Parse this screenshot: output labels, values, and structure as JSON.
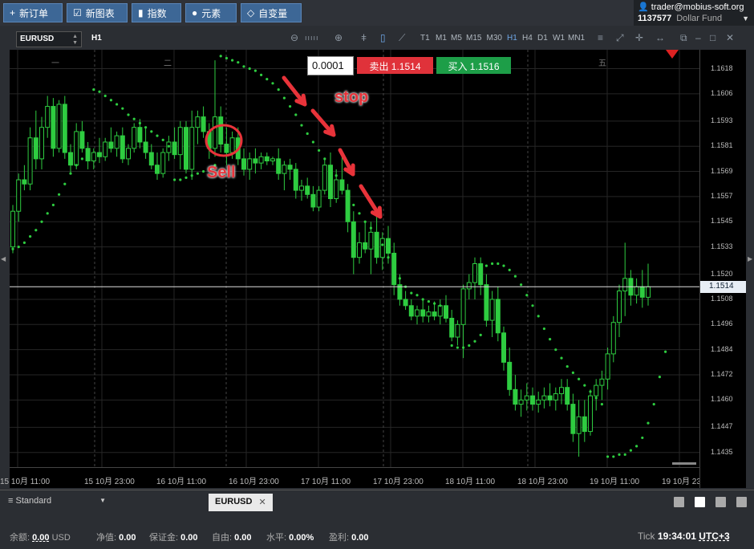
{
  "toolbar_top": {
    "new_order": "新订单",
    "new_chart": "新图表",
    "indicators": "指数",
    "elements": "元素",
    "custom_vars": "自变量"
  },
  "account": {
    "user": "trader@mobius-soft.org",
    "number": "1137577",
    "name": "Dollar Fund"
  },
  "chart_toolbar": {
    "symbol": "EURUSD",
    "period": "H1",
    "timeframes": [
      "T1",
      "M1",
      "M5",
      "M15",
      "M30",
      "H1",
      "H4",
      "D1",
      "W1",
      "MN1"
    ],
    "active_timeframe": "H1"
  },
  "trade_panel": {
    "lot": "0.0001",
    "sell_label": "卖出 1.1514",
    "buy_label": "买入 1.1516"
  },
  "annotations": {
    "stop": "stop",
    "sell": "Sell"
  },
  "day_labels": [
    "一",
    "二",
    "五"
  ],
  "current_price": "1.1514",
  "chart_data": {
    "type": "candlestick",
    "symbol": "EURUSD",
    "timeframe": "H1",
    "x_ticks": [
      "15 10月 11:00",
      "15 10月 23:00",
      "16 10月 11:00",
      "16 10月 23:00",
      "17 10月 11:00",
      "17 10月 23:00",
      "18 10月 11:00",
      "18 10月 23:00",
      "19 10月 11:00",
      "19 10月 23:00"
    ],
    "x_tick_first_partial": "15 10月 11:00",
    "y_ticks": [
      "1.1618",
      "1.1606",
      "1.1593",
      "1.1581",
      "1.1569",
      "1.1557",
      "1.1545",
      "1.1533",
      "1.1520",
      "1.1508",
      "1.1496",
      "1.1484",
      "1.1472",
      "1.1460",
      "1.1447",
      "1.1435"
    ],
    "ylim": [
      1.1428,
      1.1627
    ],
    "current_price": 1.1514,
    "indicator": "Parabolic SAR",
    "colors": {
      "bull": "#2ecc40",
      "bear": "#2ecc40",
      "sar": "#2ecc40",
      "background": "#000000",
      "grid": "#2a2a2a"
    },
    "candles": [
      [
        1.1533,
        1.1553,
        1.153,
        1.155
      ],
      [
        1.155,
        1.1568,
        1.1545,
        1.1565
      ],
      [
        1.1565,
        1.1572,
        1.156,
        1.1563
      ],
      [
        1.1563,
        1.159,
        1.156,
        1.1585
      ],
      [
        1.1585,
        1.1598,
        1.157,
        1.1575
      ],
      [
        1.1575,
        1.1595,
        1.157,
        1.159
      ],
      [
        1.159,
        1.1605,
        1.1585,
        1.16
      ],
      [
        1.16,
        1.1604,
        1.1576,
        1.158
      ],
      [
        1.158,
        1.1603,
        1.1578,
        1.1601
      ],
      [
        1.1601,
        1.1605,
        1.1575,
        1.1578
      ],
      [
        1.1578,
        1.1582,
        1.1568,
        1.1572
      ],
      [
        1.1572,
        1.1592,
        1.157,
        1.1588
      ],
      [
        1.1588,
        1.1593,
        1.1578,
        1.158
      ],
      [
        1.158,
        1.1583,
        1.157,
        1.1574
      ],
      [
        1.1574,
        1.158,
        1.157,
        1.1578
      ],
      [
        1.1578,
        1.1585,
        1.1573,
        1.1576
      ],
      [
        1.1576,
        1.1585,
        1.1574,
        1.1583
      ],
      [
        1.1583,
        1.159,
        1.1578,
        1.158
      ],
      [
        1.158,
        1.1588,
        1.1576,
        1.1586
      ],
      [
        1.1586,
        1.159,
        1.1573,
        1.1575
      ],
      [
        1.1575,
        1.1582,
        1.1572,
        1.158
      ],
      [
        1.158,
        1.1592,
        1.1578,
        1.159
      ],
      [
        1.159,
        1.1594,
        1.158,
        1.1583
      ],
      [
        1.1583,
        1.159,
        1.1575,
        1.1578
      ],
      [
        1.1578,
        1.1582,
        1.157,
        1.1572
      ],
      [
        1.1572,
        1.1578,
        1.1565,
        1.1568
      ],
      [
        1.1568,
        1.158,
        1.1566,
        1.1578
      ],
      [
        1.1578,
        1.1586,
        1.1574,
        1.1583
      ],
      [
        1.1583,
        1.159,
        1.1575,
        1.1577
      ],
      [
        1.1577,
        1.1593,
        1.157,
        1.159
      ],
      [
        1.159,
        1.1593,
        1.1568,
        1.157
      ],
      [
        1.157,
        1.1598,
        1.1565,
        1.159
      ],
      [
        1.159,
        1.1598,
        1.1582,
        1.1595
      ],
      [
        1.1595,
        1.16,
        1.1585,
        1.1588
      ],
      [
        1.1588,
        1.1592,
        1.1575,
        1.158
      ],
      [
        1.158,
        1.1622,
        1.1576,
        1.1595
      ],
      [
        1.1595,
        1.16,
        1.1578,
        1.1582
      ],
      [
        1.1582,
        1.159,
        1.1572,
        1.1578
      ],
      [
        1.1578,
        1.1588,
        1.1575,
        1.1585
      ],
      [
        1.1585,
        1.159,
        1.1572,
        1.1575
      ],
      [
        1.1575,
        1.158,
        1.1567,
        1.157
      ],
      [
        1.157,
        1.1578,
        1.1565,
        1.1575
      ],
      [
        1.1575,
        1.158,
        1.1568,
        1.1573
      ],
      [
        1.1573,
        1.1578,
        1.157,
        1.1576
      ],
      [
        1.1576,
        1.1578,
        1.1572,
        1.1574
      ],
      [
        1.1574,
        1.1576,
        1.1572,
        1.1575
      ],
      [
        1.1575,
        1.158,
        1.1565,
        1.1568
      ],
      [
        1.1568,
        1.1574,
        1.156,
        1.1572
      ],
      [
        1.1572,
        1.1575,
        1.1565,
        1.157
      ],
      [
        1.157,
        1.1573,
        1.1556,
        1.156
      ],
      [
        1.156,
        1.1565,
        1.1555,
        1.1562
      ],
      [
        1.1562,
        1.1566,
        1.1556,
        1.1558
      ],
      [
        1.1558,
        1.1562,
        1.155,
        1.1552
      ],
      [
        1.1552,
        1.1562,
        1.155,
        1.156
      ],
      [
        1.156,
        1.1575,
        1.1558,
        1.1572
      ],
      [
        1.1572,
        1.1578,
        1.1552,
        1.1556
      ],
      [
        1.1556,
        1.157,
        1.1554,
        1.1565
      ],
      [
        1.1565,
        1.1578,
        1.1558,
        1.156
      ],
      [
        1.156,
        1.1563,
        1.154,
        1.1545
      ],
      [
        1.1545,
        1.155,
        1.152,
        1.1528
      ],
      [
        1.1528,
        1.154,
        1.1525,
        1.1535
      ],
      [
        1.1535,
        1.1545,
        1.153,
        1.1532
      ],
      [
        1.1532,
        1.1545,
        1.152,
        1.154
      ],
      [
        1.154,
        1.155,
        1.1525,
        1.1528
      ],
      [
        1.1528,
        1.154,
        1.1522,
        1.1537
      ],
      [
        1.1537,
        1.1543,
        1.1525,
        1.153
      ],
      [
        1.153,
        1.1535,
        1.151,
        1.1515
      ],
      [
        1.1515,
        1.152,
        1.1505,
        1.1508
      ],
      [
        1.1508,
        1.1512,
        1.1503,
        1.1505
      ],
      [
        1.1505,
        1.1508,
        1.1498,
        1.15
      ],
      [
        1.15,
        1.1505,
        1.1496,
        1.1503
      ],
      [
        1.1503,
        1.1508,
        1.1497,
        1.15
      ],
      [
        1.15,
        1.1505,
        1.1497,
        1.1502
      ],
      [
        1.1502,
        1.1507,
        1.1498,
        1.15
      ],
      [
        1.15,
        1.1508,
        1.1496,
        1.1505
      ],
      [
        1.1505,
        1.151,
        1.1497,
        1.1499
      ],
      [
        1.1499,
        1.1503,
        1.1488,
        1.149
      ],
      [
        1.149,
        1.1498,
        1.1486,
        1.1496
      ],
      [
        1.1496,
        1.1515,
        1.148,
        1.1513
      ],
      [
        1.1513,
        1.152,
        1.1508,
        1.1516
      ],
      [
        1.1516,
        1.1528,
        1.1508,
        1.1525
      ],
      [
        1.1525,
        1.1528,
        1.151,
        1.1515
      ],
      [
        1.1515,
        1.152,
        1.1495,
        1.1498
      ],
      [
        1.1498,
        1.1512,
        1.149,
        1.1508
      ],
      [
        1.1508,
        1.1514,
        1.1488,
        1.1492
      ],
      [
        1.1492,
        1.1495,
        1.1474,
        1.1478
      ],
      [
        1.1478,
        1.1485,
        1.1462,
        1.1465
      ],
      [
        1.1465,
        1.1472,
        1.1455,
        1.1458
      ],
      [
        1.1458,
        1.1465,
        1.1452,
        1.146
      ],
      [
        1.146,
        1.1468,
        1.1455,
        1.1462
      ],
      [
        1.1462,
        1.1466,
        1.1455,
        1.1458
      ],
      [
        1.1458,
        1.1464,
        1.1454,
        1.146
      ],
      [
        1.146,
        1.1466,
        1.1456,
        1.1462
      ],
      [
        1.1462,
        1.1468,
        1.1457,
        1.146
      ],
      [
        1.146,
        1.1466,
        1.1455,
        1.1463
      ],
      [
        1.1463,
        1.147,
        1.1458,
        1.1466
      ],
      [
        1.1466,
        1.147,
        1.1455,
        1.1458
      ],
      [
        1.1458,
        1.1463,
        1.144,
        1.1444
      ],
      [
        1.1444,
        1.146,
        1.1433,
        1.1452
      ],
      [
        1.1452,
        1.146,
        1.144,
        1.1445
      ],
      [
        1.1445,
        1.1465,
        1.1443,
        1.1462
      ],
      [
        1.1462,
        1.147,
        1.1455,
        1.1467
      ],
      [
        1.1467,
        1.1474,
        1.146,
        1.147
      ],
      [
        1.147,
        1.1485,
        1.1465,
        1.1482
      ],
      [
        1.1482,
        1.15,
        1.1478,
        1.1497
      ],
      [
        1.1497,
        1.1515,
        1.149,
        1.1512
      ],
      [
        1.1512,
        1.1535,
        1.15,
        1.1518
      ],
      [
        1.1518,
        1.1522,
        1.1505,
        1.151
      ],
      [
        1.151,
        1.1518,
        1.1506,
        1.1514
      ],
      [
        1.1514,
        1.1522,
        1.1504,
        1.1509
      ],
      [
        1.1509,
        1.1525,
        1.1505,
        1.1514
      ]
    ],
    "sar": [
      [
        0,
        1.1532
      ],
      [
        1,
        1.1533
      ],
      [
        2,
        1.1535
      ],
      [
        3,
        1.1538
      ],
      [
        4,
        1.1541
      ],
      [
        5,
        1.1545
      ],
      [
        6,
        1.1549
      ],
      [
        7,
        1.1553
      ],
      [
        8,
        1.1558
      ],
      [
        9,
        1.1563
      ],
      [
        10,
        1.1568
      ],
      [
        11,
        1.1572
      ],
      [
        12,
        1.1575
      ],
      [
        13,
        1.1578
      ],
      [
        14,
        1.1608
      ],
      [
        15,
        1.1607
      ],
      [
        16,
        1.1605
      ],
      [
        17,
        1.1603
      ],
      [
        18,
        1.1601
      ],
      [
        19,
        1.1599
      ],
      [
        20,
        1.1596
      ],
      [
        21,
        1.1594
      ],
      [
        22,
        1.1592
      ],
      [
        23,
        1.159
      ],
      [
        24,
        1.1588
      ],
      [
        25,
        1.1586
      ],
      [
        26,
        1.1584
      ],
      [
        27,
        1.1581
      ],
      [
        28,
        1.1565
      ],
      [
        29,
        1.1565
      ],
      [
        30,
        1.1566
      ],
      [
        31,
        1.1567
      ],
      [
        32,
        1.1568
      ],
      [
        33,
        1.1569
      ],
      [
        34,
        1.157
      ],
      [
        35,
        1.1572
      ],
      [
        36,
        1.1624
      ],
      [
        37,
        1.1623
      ],
      [
        38,
        1.1622
      ],
      [
        39,
        1.1621
      ],
      [
        40,
        1.1619
      ],
      [
        41,
        1.1618
      ],
      [
        42,
        1.1617
      ],
      [
        43,
        1.1615
      ],
      [
        44,
        1.1613
      ],
      [
        45,
        1.1611
      ],
      [
        46,
        1.1608
      ],
      [
        47,
        1.1604
      ],
      [
        48,
        1.16
      ],
      [
        49,
        1.1596
      ],
      [
        50,
        1.1591
      ],
      [
        51,
        1.1587
      ],
      [
        52,
        1.1583
      ],
      [
        53,
        1.1579
      ],
      [
        54,
        1.1575
      ],
      [
        55,
        1.1571
      ],
      [
        56,
        1.1567
      ],
      [
        57,
        1.1562
      ],
      [
        58,
        1.1558
      ],
      [
        59,
        1.1553
      ],
      [
        60,
        1.1549
      ],
      [
        61,
        1.1545
      ],
      [
        62,
        1.1542
      ],
      [
        63,
        1.1538
      ],
      [
        64,
        1.1534
      ],
      [
        65,
        1.1528
      ],
      [
        66,
        1.1523
      ],
      [
        67,
        1.1518
      ],
      [
        68,
        1.1514
      ],
      [
        69,
        1.1511
      ],
      [
        70,
        1.151
      ],
      [
        71,
        1.1508
      ],
      [
        72,
        1.1507
      ],
      [
        73,
        1.1506
      ],
      [
        74,
        1.1505
      ],
      [
        75,
        1.1504
      ],
      [
        76,
        1.1486
      ],
      [
        77,
        1.1485
      ],
      [
        78,
        1.1485
      ],
      [
        79,
        1.1486
      ],
      [
        80,
        1.1488
      ],
      [
        81,
        1.1491
      ],
      [
        82,
        1.1524
      ],
      [
        83,
        1.1525
      ],
      [
        84,
        1.1525
      ],
      [
        85,
        1.1524
      ],
      [
        86,
        1.1522
      ],
      [
        87,
        1.1519
      ],
      [
        88,
        1.1515
      ],
      [
        89,
        1.151
      ],
      [
        90,
        1.1505
      ],
      [
        91,
        1.15
      ],
      [
        92,
        1.1494
      ],
      [
        93,
        1.1489
      ],
      [
        94,
        1.1484
      ],
      [
        95,
        1.148
      ],
      [
        96,
        1.1476
      ],
      [
        97,
        1.1473
      ],
      [
        98,
        1.147
      ],
      [
        99,
        1.1467
      ],
      [
        100,
        1.1464
      ],
      [
        101,
        1.1461
      ],
      [
        102,
        1.1458
      ],
      [
        103,
        1.1433
      ],
      [
        104,
        1.1433
      ],
      [
        105,
        1.1434
      ],
      [
        106,
        1.1434
      ],
      [
        107,
        1.1436
      ],
      [
        108,
        1.1438
      ],
      [
        109,
        1.1442
      ],
      [
        110,
        1.1449
      ],
      [
        111,
        1.1458
      ],
      [
        112,
        1.1471
      ],
      [
        113,
        1.1483
      ]
    ]
  },
  "bottom_tabs": {
    "layout": "Standard",
    "active_tab": "EURUSD"
  },
  "status": {
    "balance_label": "余额:",
    "balance": "0.00",
    "currency": "USD",
    "equity_label": "净值:",
    "equity": "0.00",
    "margin_label": "保证金:",
    "margin": "0.00",
    "free_label": "自由:",
    "free": "0.00",
    "level_label": "水平:",
    "level": "0.00%",
    "profit_label": "盈利:",
    "profit": "0.00",
    "tick_label": "Tick",
    "time": "19:34:01",
    "tz": "UTC+3"
  }
}
